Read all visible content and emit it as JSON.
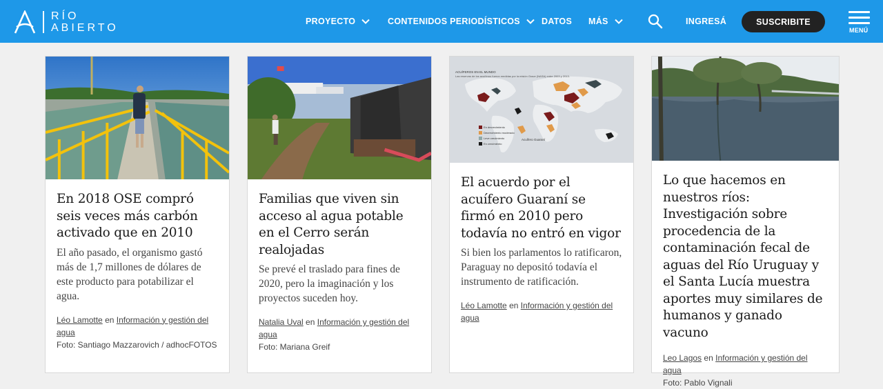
{
  "header": {
    "logo_line1": "RÍO",
    "logo_line2": "ABIERTO",
    "nav": [
      {
        "label": "PROYECTO"
      },
      {
        "label": "CONTENIDOS PERIODÍSTICOS"
      },
      {
        "label": "DATOS"
      },
      {
        "label": "MÁS"
      }
    ],
    "login_label": "INGRESÁ",
    "subscribe_label": "SUSCRIBITE",
    "menu_label": "MENÚ"
  },
  "map_legend": {
    "title": "ACUÍFEROS EN EL MUNDO",
    "subtitle": "Las reservas de los acuíferos fueron medidas por la misión Grace (NASA) entre 2003 y 2013.",
    "items": [
      "En decrecimiento",
      "Decrecimiento moderado",
      "Leve crecimiento",
      "En crecimiento"
    ],
    "guarani_label": "Acuífero Guaraní"
  },
  "cards": [
    {
      "title": "En 2018 OSE compró seis veces más carbón activado que en 2010",
      "summary": "El año pasado, el organismo gastó más de 1,7 millones de dólares de este producto para potabilizar el agua.",
      "author": "Léo Lamotte",
      "conj": "en",
      "category": "Información y gestión del agua",
      "photo": "Foto: Santiago Mazzarovich / adhocFOTOS"
    },
    {
      "title": "Familias que viven sin acceso al agua potable en el Cerro serán realojadas",
      "summary": "Se prevé el traslado para fines de 2020, pero la imaginación y los proyectos suceden hoy.",
      "author": "Natalia Uval",
      "conj": "en",
      "category": "Información y gestión del agua",
      "photo": "Foto: Mariana Greif"
    },
    {
      "title": "El acuerdo por el acuífero Guaraní se firmó en 2010 pero todavía no entró en vigor",
      "summary": "Si bien los parlamentos lo ratificaron, Paraguay no depositó todavía el instrumento de ratificación.",
      "author": "Léo Lamotte",
      "conj": "en",
      "category": "Información y gestión del agua",
      "photo": ""
    },
    {
      "title": "Lo que hacemos en nuestros ríos: Investigación sobre procedencia de la contaminación fecal de aguas del Río Uruguay y el Santa Lucía muestra aportes muy similares de humanos y ganado vacuno",
      "summary": "",
      "author": "Leo Lagos",
      "conj": "en",
      "category": "Información y gestión del agua",
      "photo": "Foto: Pablo Vignali"
    }
  ]
}
